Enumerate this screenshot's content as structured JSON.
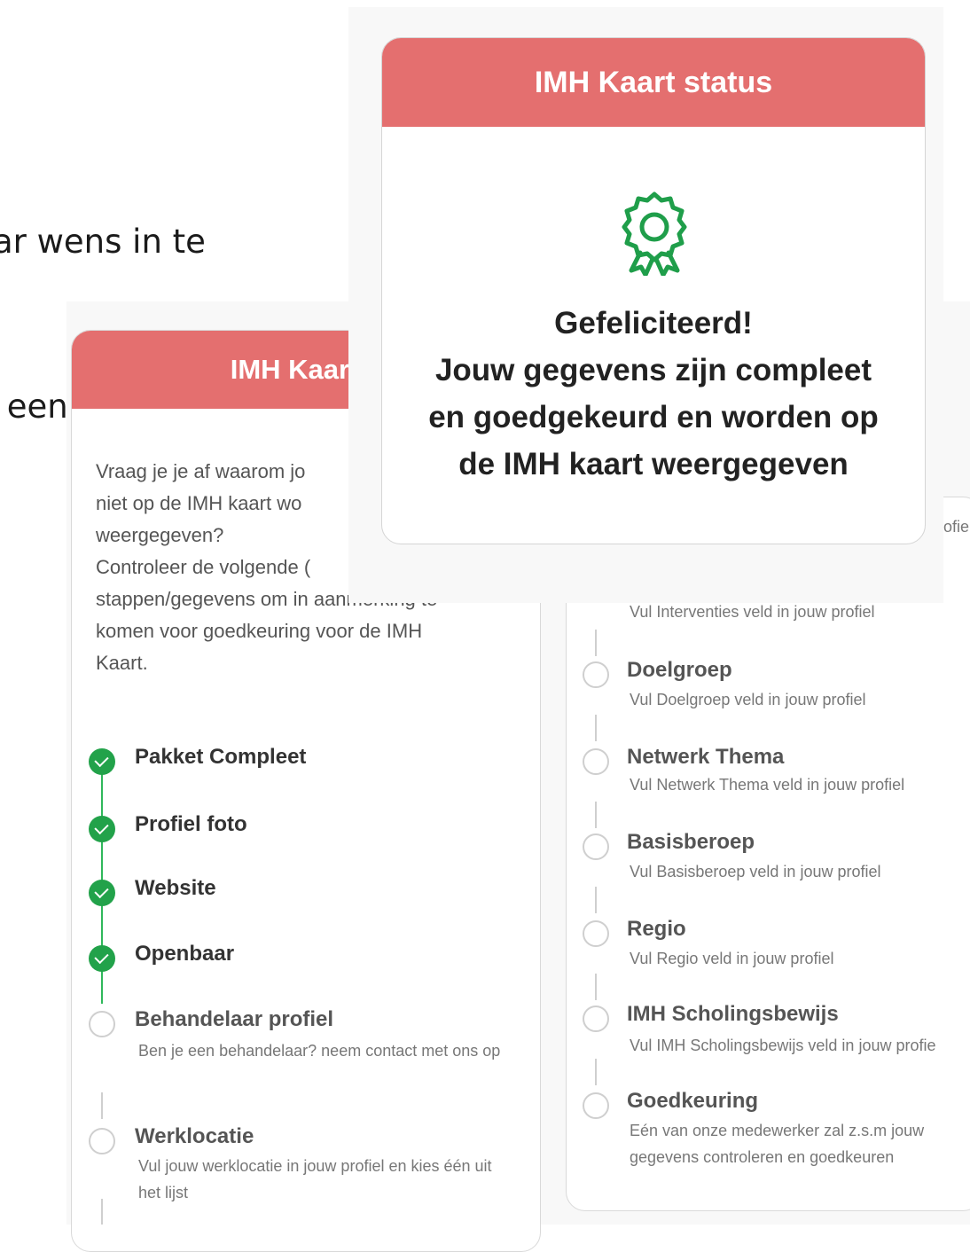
{
  "background_text": {
    "line1": "ar wens in te",
    "line2": " een kaart die"
  },
  "left_panel": {
    "header": "IMH Kaart s",
    "intro": [
      "Vraag je je af waarom jo",
      "niet op de IMH kaart wo",
      "weergegeven?",
      "Controleer de volgende (",
      "stappen/gegevens om in aanmerking te",
      "komen voor goedkeuring voor de IMH",
      "Kaart."
    ],
    "steps": [
      {
        "title": "Pakket Compleet",
        "status": "done"
      },
      {
        "title": "Profiel foto",
        "status": "done"
      },
      {
        "title": "Website",
        "status": "done"
      },
      {
        "title": "Openbaar",
        "status": "done"
      },
      {
        "title": "Behandelaar profiel",
        "status": "todo",
        "desc": "Ben je een behandelaar? neem contact met ons op"
      },
      {
        "title": "Werklocatie",
        "status": "todo",
        "desc": "Vul jouw werklocatie in jouw profiel en kies één uit het lijst"
      }
    ]
  },
  "right_panel": {
    "peek_top": "ofie",
    "peek_interventies": "Vul Interventies veld in jouw profiel",
    "steps": [
      {
        "title": "Doelgroep",
        "desc": "Vul Doelgroep veld in jouw profiel"
      },
      {
        "title": "Netwerk Thema",
        "desc": "Vul Netwerk Thema veld in jouw profiel"
      },
      {
        "title": "Basisberoep",
        "desc": "Vul Basisberoep veld in jouw profiel"
      },
      {
        "title": "Regio",
        "desc": "Vul Regio veld in jouw profiel"
      },
      {
        "title": "IMH Scholingsbewijs",
        "desc": "Vul IMH Scholingsbewijs veld in jouw profie"
      },
      {
        "title": "Goedkeuring",
        "desc": "Eén van onze medewerker zal z.s.m jouw gegevens controleren en goedkeuren"
      }
    ]
  },
  "status_card": {
    "header": "IMH Kaart status",
    "icon": "award-ribbon-icon",
    "lines": [
      "Gefeliciteerd!",
      "Jouw gegevens zijn compleet",
      "en goedgekeurd en worden op",
      "de IMH kaart weergegeven"
    ]
  },
  "colors": {
    "header_red": "#e46f6f",
    "done_green": "#22a24a",
    "icon_green": "#1f9e4a"
  }
}
